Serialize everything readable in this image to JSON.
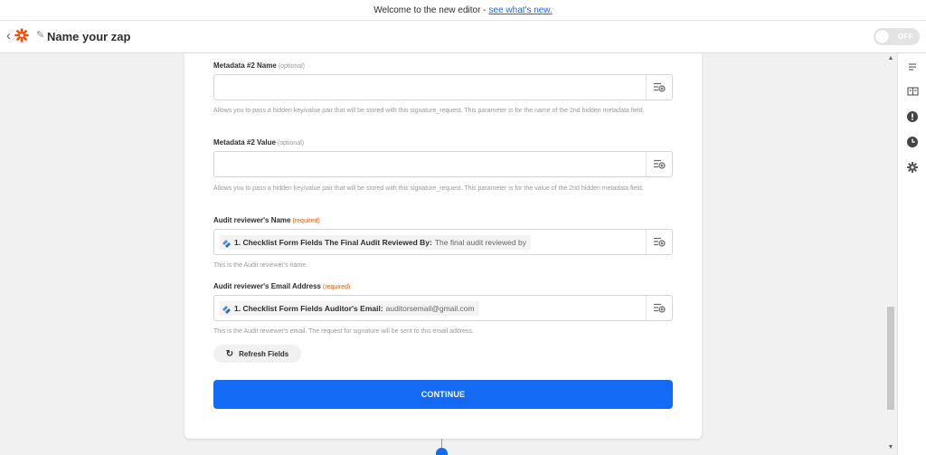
{
  "banner": {
    "text": "Welcome to the new editor - ",
    "link": "see what's new."
  },
  "header": {
    "zap_name": "Name your zap",
    "toggle_label": "OFF"
  },
  "form": {
    "fields": [
      {
        "label": "Metadata #2 Name",
        "tag": "(optional)",
        "value": "",
        "help": "Allows you to pass a hidden key/value pair that will be stored with this signature_request. This parameter is for the name of the 2nd hidden metadata field."
      },
      {
        "label": "Metadata #2 Value",
        "tag": "(optional)",
        "value": "",
        "help": "Allows you to pass a hidden key/value pair that will be stored with this signature_request. This parameter is for the value of the 2nd hidden metadata field."
      },
      {
        "label": "Audit reviewer's Name",
        "tag": "(required)",
        "pill": {
          "step": "1. Checklist Form Fields The Final Audit Reviewed By:",
          "value": "The final audit reviewed by"
        },
        "help": "This is the Audit reviewer's name."
      },
      {
        "label": "Audit reviewer's Email Address",
        "tag": "(required)",
        "pill": {
          "step": "1. Checklist Form Fields Auditor's Email:",
          "value": "auditorsemail@gmail.com"
        },
        "help": "This is the Audit reviewer's email. The request for signature will be sent to this email address."
      }
    ],
    "refresh_label": "Refresh Fields",
    "continue_label": "CONTINUE"
  },
  "icons": {
    "back": "chevron-left-icon",
    "logo": "zapier-asterisk-icon",
    "edit": "pencil-icon",
    "insert_data": "insert-data-icon",
    "refresh": "refresh-icon",
    "sidebar": [
      "outline-icon",
      "guide-book-icon",
      "alert-icon",
      "history-clock-icon",
      "settings-gear-icon"
    ]
  },
  "colors": {
    "accent": "#136bf5",
    "brand": "#ff4a00",
    "required": "#e05c12"
  }
}
